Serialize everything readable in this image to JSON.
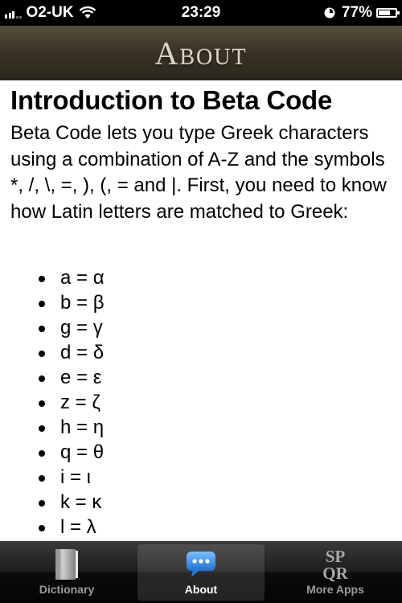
{
  "status_bar": {
    "carrier": "O2-UK",
    "time": "23:29",
    "battery": "77%",
    "battery_level": 0.77
  },
  "header": {
    "title": "About"
  },
  "content": {
    "heading": "Introduction to Beta Code",
    "paragraph": "Beta Code lets you type Greek characters using a combination of A-Z and the symbols *, /, \\, =, ), (, = and |. First, you need to know how Latin letters are matched to Greek:",
    "mappings": [
      "a = α",
      "b = β",
      "g = γ",
      "d = δ",
      "e = ε",
      "z = ζ",
      "h = η",
      "q = θ",
      "i = ι",
      "k = κ",
      "l = λ"
    ]
  },
  "tab_bar": {
    "tabs": [
      {
        "label": "Dictionary",
        "icon": "book-icon",
        "active": false
      },
      {
        "label": "About",
        "icon": "speech-bubble-icon",
        "active": true
      },
      {
        "label": "More Apps",
        "icon": "spqr-icon",
        "active": false
      }
    ],
    "spqr_lines": [
      "SP",
      "QR"
    ]
  },
  "colors": {
    "header_bg": "#3a3427",
    "tab_active_bg": "#2e2e2e",
    "bubble_blue": "#3b8fe0"
  }
}
